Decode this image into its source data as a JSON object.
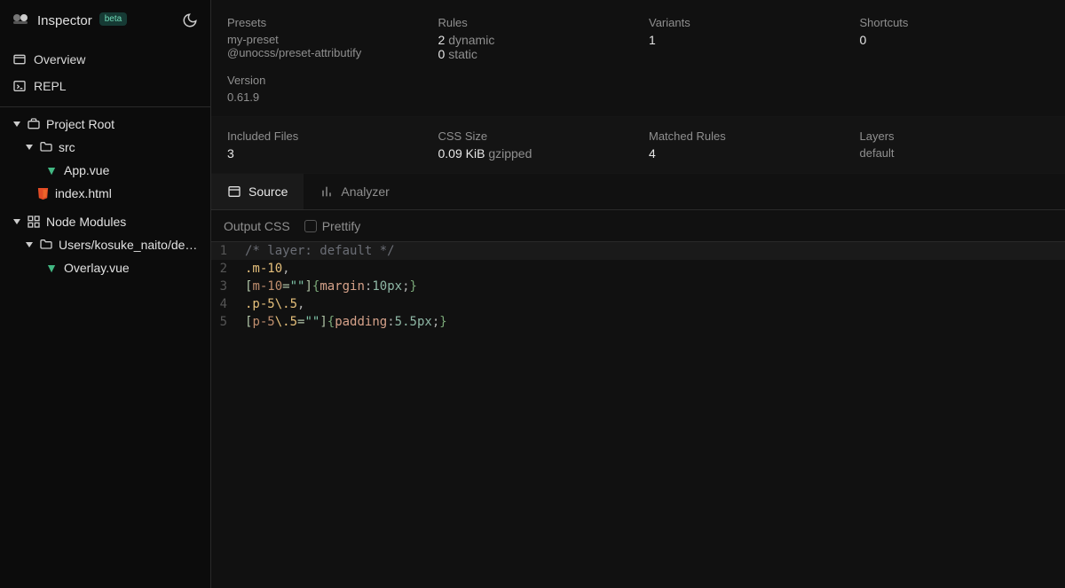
{
  "header": {
    "app_name": "Inspector",
    "badge": "beta"
  },
  "nav": {
    "overview": "Overview",
    "repl": "REPL"
  },
  "tree": {
    "project_root": "Project Root",
    "src": "src",
    "app_vue": "App.vue",
    "index_html": "index.html",
    "node_modules": "Node Modules",
    "nm_path": "Users/kosuke_naito/dev/lear...",
    "overlay_vue": "Overlay.vue"
  },
  "stats": {
    "presets_label": "Presets",
    "presets_val1": "my-preset",
    "presets_val2": "@unocss/preset-attributify",
    "rules_label": "Rules",
    "rules_dynamic_n": "2",
    "rules_dynamic_l": "dynamic",
    "rules_static_n": "0",
    "rules_static_l": "static",
    "variants_label": "Variants",
    "variants_val": "1",
    "shortcuts_label": "Shortcuts",
    "shortcuts_val": "0",
    "version_label": "Version",
    "version_val": "0.61.9"
  },
  "stats2": {
    "files_label": "Included Files",
    "files_val": "3",
    "css_label": "CSS Size",
    "css_val": "0.09 KiB",
    "css_sub": "gzipped",
    "matched_label": "Matched Rules",
    "matched_val": "4",
    "layers_label": "Layers",
    "layers_val": "default"
  },
  "tabs": {
    "source": "Source",
    "analyzer": "Analyzer"
  },
  "outputbar": {
    "label": "Output CSS",
    "prettify": "Prettify"
  },
  "code": {
    "l1": "/* layer: default */",
    "l2_a": ".m-10",
    "l2_b": ",",
    "l3_a": "[",
    "l3_b": "m-10",
    "l3_c": "=",
    "l3_d": "\"\"",
    "l3_e": "]",
    "l3_f": "{",
    "l3_g": "margin",
    "l3_h": ":",
    "l3_i": "10px",
    "l3_j": ";",
    "l3_k": "}",
    "l4_a": ".p-5\\.5",
    "l4_b": ",",
    "l5_a": "[",
    "l5_b": "p-5",
    "l5_c": "\\.5",
    "l5_d": "=",
    "l5_e": "\"\"",
    "l5_f": "]",
    "l5_g": "{",
    "l5_h": "padding",
    "l5_i": ":",
    "l5_j": "5.5px",
    "l5_k": ";",
    "l5_l": "}"
  }
}
